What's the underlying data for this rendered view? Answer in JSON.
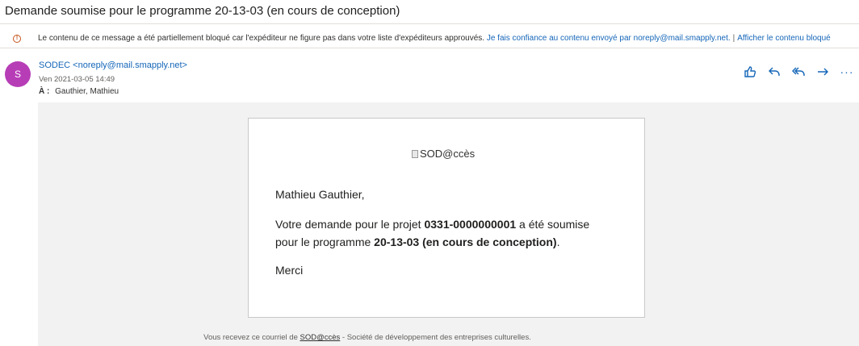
{
  "email": {
    "subject": "Demande soumise pour le programme 20-13-03 (en cours de conception)",
    "warning": {
      "text": "Le contenu de ce message a été partiellement bloqué car l'expéditeur ne figure pas dans votre liste d'expéditeurs approuvés.",
      "trust_link": "Je fais confiance au contenu envoyé par noreply@mail.smapply.net.",
      "separator": "|",
      "show_link": "Afficher le contenu bloqué"
    },
    "avatar_letter": "S",
    "sender": "SODEC <noreply@mail.smapply.net>",
    "date": "Ven 2021-03-05 14:49",
    "to_label": "À :",
    "to_value": "Gauthier, Mathieu",
    "more_label": "···"
  },
  "message": {
    "logo_alt": "SOD@ccès",
    "greeting": "Mathieu Gauthier,",
    "line1_prefix": "Votre demande pour le projet ",
    "project_id": "0331-0000000001",
    "line1_suffix": " a été soumise",
    "line2_prefix": "pour le programme ",
    "program": "20-13-03 (en cours de conception)",
    "line2_suffix": ".",
    "thanks": "Merci",
    "footer_prefix": "Vous recevez ce courriel de ",
    "footer_link": "SOD@ccès",
    "footer_suffix": " - Société de développement des entreprises culturelles."
  },
  "colors": {
    "accent": "#1566b8",
    "avatar": "#b73db7",
    "warning": "#c4541c"
  }
}
